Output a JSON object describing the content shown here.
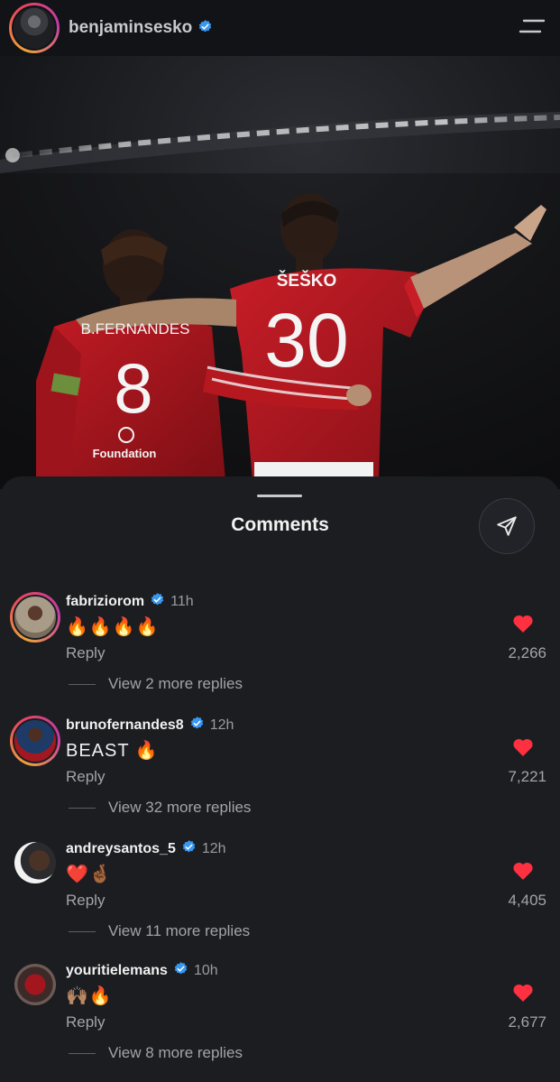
{
  "header": {
    "username": "benjaminsesko",
    "verified": true
  },
  "post": {
    "jersey_left_name": "B.FERNANDES",
    "jersey_left_number": "8",
    "jersey_left_sponsor": "Foundation",
    "jersey_right_name": "ŠEŠKO",
    "jersey_right_number": "30"
  },
  "comments_sheet": {
    "title": "Comments"
  },
  "comments": [
    {
      "username": "fabriziorom",
      "time": "11h",
      "text": "🔥🔥🔥🔥",
      "reply_label": "Reply",
      "likes": "2,266",
      "view_more": "View 2 more replies"
    },
    {
      "username": "brunofernandes8",
      "time": "12h",
      "text": "BEAST 🔥",
      "reply_label": "Reply",
      "likes": "7,221",
      "view_more": "View 32 more replies"
    },
    {
      "username": "andreysantos_5",
      "time": "12h",
      "text": "❤️🤞🏾",
      "reply_label": "Reply",
      "likes": "4,405",
      "view_more": "View 11 more replies"
    },
    {
      "username": "youritielemans",
      "time": "10h",
      "text": "🙌🏽🔥",
      "reply_label": "Reply",
      "likes": "2,677",
      "view_more": "View 8 more replies"
    }
  ],
  "colors": {
    "background": "#1c1d21",
    "header": "#121316",
    "verified": "#3897f0",
    "like": "#ff3040",
    "muted_text": "#a3a4a8",
    "jersey_red": "#b3161f"
  }
}
